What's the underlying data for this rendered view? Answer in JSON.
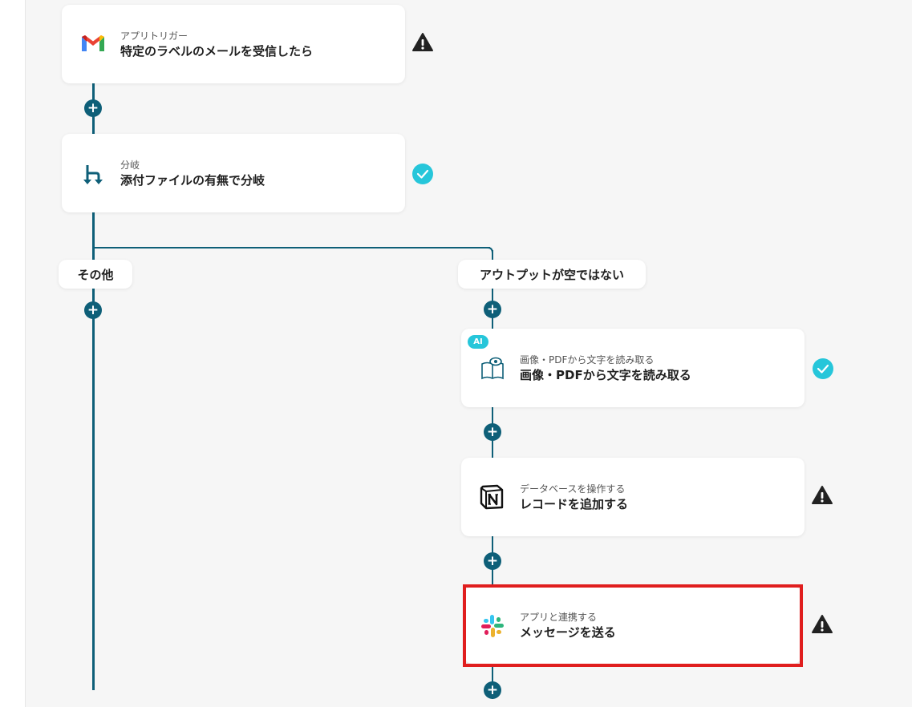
{
  "flow": {
    "trigger": {
      "sub": "アプリトリガー",
      "main": "特定のラベルのメールを受信したら",
      "icon": "gmail-icon",
      "status": "warning"
    },
    "branch": {
      "sub": "分岐",
      "main": "添付ファイルの有無で分岐",
      "icon": "branch-icon",
      "status": "ok"
    },
    "branch_left_label": "その他",
    "branch_right_label": "アウトプットが空ではない",
    "ocr": {
      "badge": "AI",
      "sub": "画像・PDFから文字を読み取る",
      "main": "画像・PDFから文字を読み取る",
      "icon": "book-eye-icon",
      "status": "ok"
    },
    "notion": {
      "sub": "データベースを操作する",
      "main": "レコードを追加する",
      "icon": "notion-icon",
      "status": "warning"
    },
    "slack": {
      "sub": "アプリと連携する",
      "main": "メッセージを送る",
      "icon": "slack-icon",
      "status": "warning",
      "highlighted": true
    },
    "plus_symbol": "+"
  },
  "colors": {
    "connector": "#0e5f78",
    "ok": "#26c6da",
    "warning": "#222222",
    "highlight": "#e01e1e",
    "canvas": "#f6f6f6"
  }
}
